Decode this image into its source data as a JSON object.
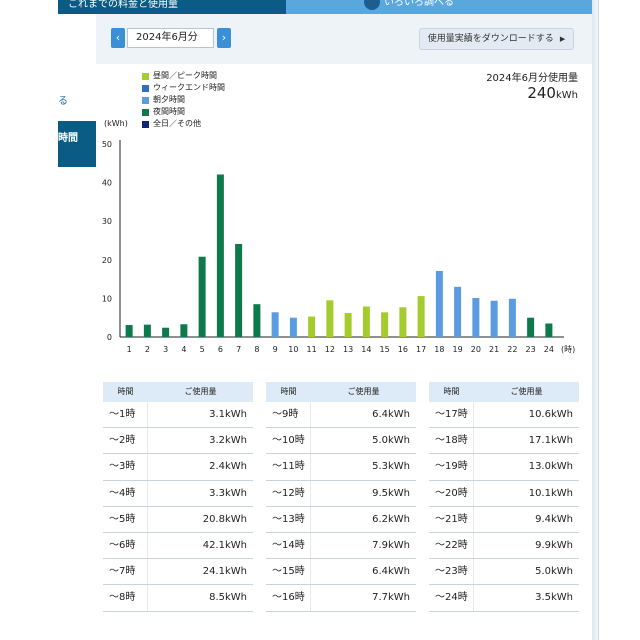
{
  "header": {
    "tab_left_label": "これまでの料金と使用量",
    "tab_right_label": "いろいろ調べる"
  },
  "sidebar": {
    "link_label": "る",
    "selected_label": "時間"
  },
  "toolbar": {
    "prev_label": "‹",
    "next_label": "›",
    "month_value": "2024年6月分",
    "download_label": "使用量実績をダウンロードする",
    "download_arrow": "▶"
  },
  "summary": {
    "label": "2024年6月分使用量",
    "value": "240",
    "unit": "kWh"
  },
  "legend": [
    {
      "label": "昼間／ピーク時間",
      "color": "#a4cc2e"
    },
    {
      "label": "ウィークエンド時間",
      "color": "#2f6fc4"
    },
    {
      "label": "朝夕時間",
      "color": "#5b9be0"
    },
    {
      "label": "夜間時間",
      "color": "#0e7a4c"
    },
    {
      "label": "全日／その他",
      "color": "#13237a"
    }
  ],
  "chart_data": {
    "type": "bar",
    "ylabel": "(kWh)",
    "xunit": "(時)",
    "ylim": [
      0,
      50
    ],
    "yticks": [
      0,
      10,
      20,
      30,
      40,
      50
    ],
    "categories": [
      "1",
      "2",
      "3",
      "4",
      "5",
      "6",
      "7",
      "8",
      "9",
      "10",
      "11",
      "12",
      "13",
      "14",
      "15",
      "16",
      "17",
      "18",
      "19",
      "20",
      "21",
      "22",
      "23",
      "24"
    ],
    "values": [
      3.1,
      3.2,
      2.4,
      3.3,
      20.8,
      42.1,
      24.1,
      8.5,
      6.4,
      5.0,
      5.3,
      9.5,
      6.2,
      7.9,
      6.4,
      7.7,
      10.6,
      17.1,
      13.0,
      10.1,
      9.4,
      9.9,
      5.0,
      3.5
    ],
    "colors": [
      "#0e7a4c",
      "#0e7a4c",
      "#0e7a4c",
      "#0e7a4c",
      "#0e7a4c",
      "#0e7a4c",
      "#0e7a4c",
      "#0e7a4c",
      "#5b9be0",
      "#5b9be0",
      "#a4cc2e",
      "#a4cc2e",
      "#a4cc2e",
      "#a4cc2e",
      "#a4cc2e",
      "#a4cc2e",
      "#a4cc2e",
      "#5b9be0",
      "#5b9be0",
      "#5b9be0",
      "#5b9be0",
      "#5b9be0",
      "#0e7a4c",
      "#0e7a4c"
    ]
  },
  "tables": {
    "header_time": "時間",
    "header_usage": "ご使用量",
    "groups": [
      [
        {
          "time": "～1時",
          "usage": "3.1kWh"
        },
        {
          "time": "～2時",
          "usage": "3.2kWh"
        },
        {
          "time": "～3時",
          "usage": "2.4kWh"
        },
        {
          "time": "～4時",
          "usage": "3.3kWh"
        },
        {
          "time": "～5時",
          "usage": "20.8kWh"
        },
        {
          "time": "～6時",
          "usage": "42.1kWh"
        },
        {
          "time": "～7時",
          "usage": "24.1kWh"
        },
        {
          "time": "～8時",
          "usage": "8.5kWh"
        }
      ],
      [
        {
          "time": "～9時",
          "usage": "6.4kWh"
        },
        {
          "time": "～10時",
          "usage": "5.0kWh"
        },
        {
          "time": "～11時",
          "usage": "5.3kWh"
        },
        {
          "time": "～12時",
          "usage": "9.5kWh"
        },
        {
          "time": "～13時",
          "usage": "6.2kWh"
        },
        {
          "time": "～14時",
          "usage": "7.9kWh"
        },
        {
          "time": "～15時",
          "usage": "6.4kWh"
        },
        {
          "time": "～16時",
          "usage": "7.7kWh"
        }
      ],
      [
        {
          "time": "～17時",
          "usage": "10.6kWh"
        },
        {
          "time": "～18時",
          "usage": "17.1kWh"
        },
        {
          "time": "～19時",
          "usage": "13.0kWh"
        },
        {
          "time": "～20時",
          "usage": "10.1kWh"
        },
        {
          "time": "～21時",
          "usage": "9.4kWh"
        },
        {
          "time": "～22時",
          "usage": "9.9kWh"
        },
        {
          "time": "～23時",
          "usage": "5.0kWh"
        },
        {
          "time": "～24時",
          "usage": "3.5kWh"
        }
      ]
    ]
  }
}
